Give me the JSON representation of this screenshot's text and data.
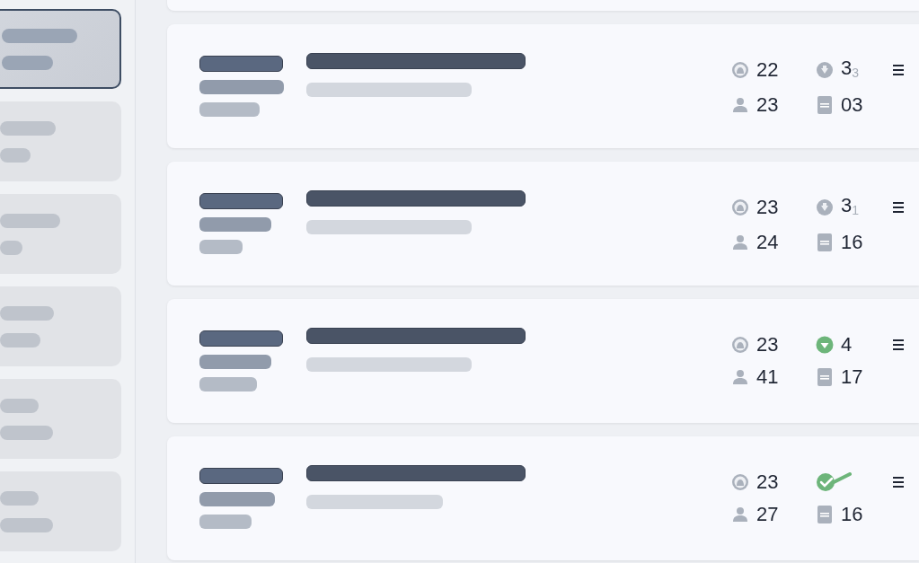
{
  "sidebar": {
    "items": [
      {
        "selected": true
      },
      {
        "selected": false
      },
      {
        "selected": false
      },
      {
        "selected": false
      },
      {
        "selected": false
      },
      {
        "selected": false
      }
    ]
  },
  "cards": [
    {
      "profile_count": "22",
      "kind": "pending",
      "status_count": "3$_{3}$",
      "user_count": "23",
      "document_count": "03"
    },
    {
      "profile_count": "23",
      "kind": "pending",
      "status_count": "3$_{1}$",
      "user_count": "24",
      "document_count": "16"
    },
    {
      "profile_count": "23",
      "kind": "down",
      "status_count": "4",
      "user_count": "41",
      "document_count": "17"
    },
    {
      "profile_count": "23",
      "kind": "done",
      "user_count": "27",
      "document_count": "16"
    }
  ]
}
